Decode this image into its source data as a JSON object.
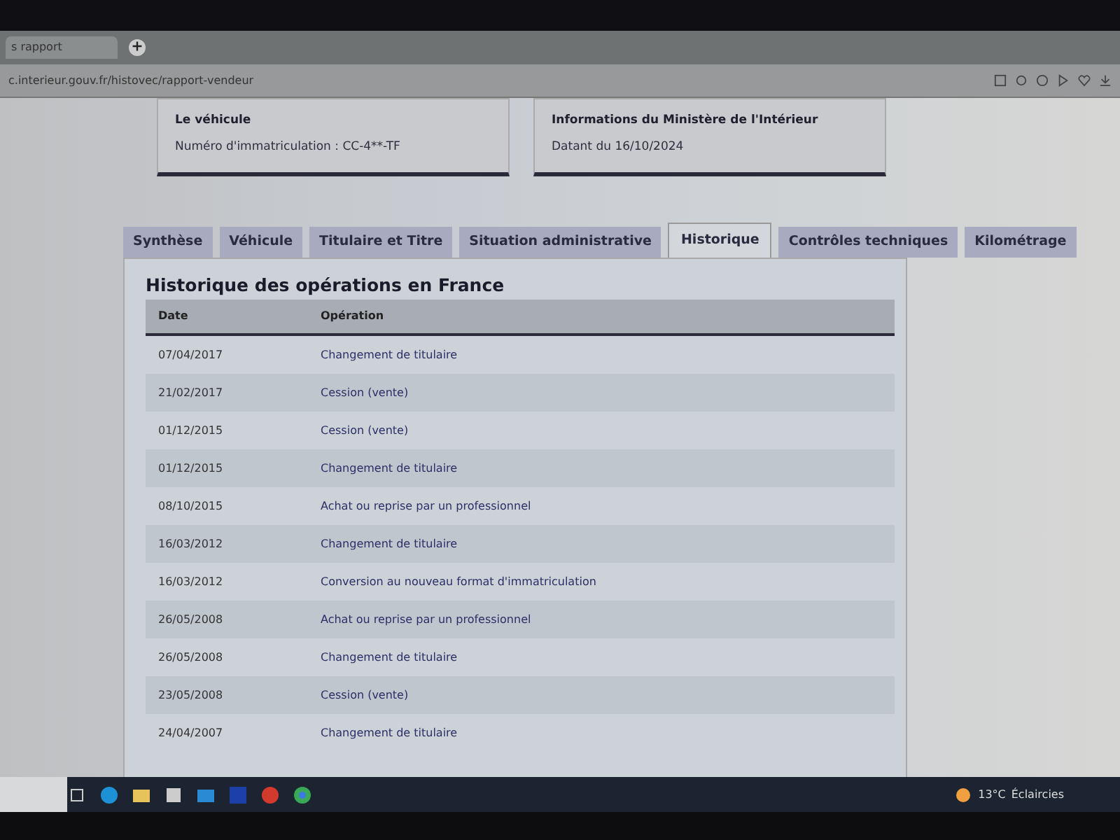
{
  "browser": {
    "tab_title": "s rapport",
    "address": "c.interieur.gouv.fr/histovec/rapport-vendeur"
  },
  "cards": [
    {
      "title": "Le véhicule",
      "text": "Numéro d'immatriculation : CC-4**-TF"
    },
    {
      "title": "Informations du Ministère de l'Intérieur",
      "text": "Datant du 16/10/2024"
    }
  ],
  "tabs": [
    {
      "label": "Synthèse",
      "selected": false
    },
    {
      "label": "Véhicule",
      "selected": false
    },
    {
      "label": "Titulaire et Titre",
      "selected": false
    },
    {
      "label": "Situation administrative",
      "selected": false
    },
    {
      "label": "Historique",
      "selected": true
    },
    {
      "label": "Contrôles techniques",
      "selected": false
    },
    {
      "label": "Kilométrage",
      "selected": false
    }
  ],
  "section_title": "Historique des opérations en France",
  "table": {
    "columns": [
      "Date",
      "Opération"
    ],
    "rows": [
      [
        "07/04/2017",
        "Changement de titulaire"
      ],
      [
        "21/02/2017",
        "Cession (vente)"
      ],
      [
        "01/12/2015",
        "Cession (vente)"
      ],
      [
        "01/12/2015",
        "Changement de titulaire"
      ],
      [
        "08/10/2015",
        "Achat ou reprise par un professionnel"
      ],
      [
        "16/03/2012",
        "Changement de titulaire"
      ],
      [
        "16/03/2012",
        "Conversion au nouveau format d'immatriculation"
      ],
      [
        "26/05/2008",
        "Achat ou reprise par un professionnel"
      ],
      [
        "26/05/2008",
        "Changement de titulaire"
      ],
      [
        "23/05/2008",
        "Cession (vente)"
      ],
      [
        "24/04/2007",
        "Changement de titulaire"
      ]
    ]
  },
  "taskbar": {
    "weather": "13°C",
    "weather_text": "Éclaircies"
  }
}
